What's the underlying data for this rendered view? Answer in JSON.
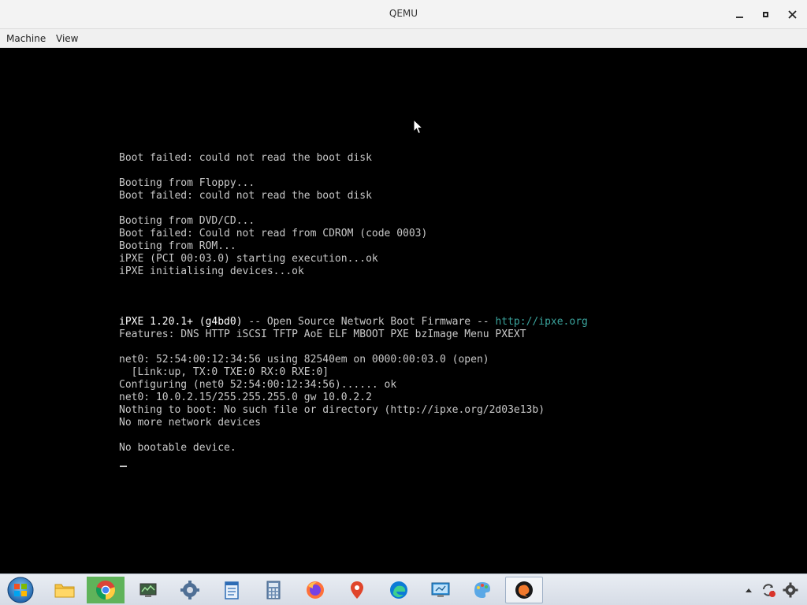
{
  "window": {
    "title": "QEMU"
  },
  "menu": {
    "items": [
      "Machine",
      "View"
    ]
  },
  "console": {
    "lines": [
      {
        "text": "Boot failed: could not read the boot disk"
      },
      {
        "text": ""
      },
      {
        "text": "Booting from Floppy..."
      },
      {
        "text": "Boot failed: could not read the boot disk"
      },
      {
        "text": ""
      },
      {
        "text": "Booting from DVD/CD..."
      },
      {
        "text": "Boot failed: Could not read from CDROM (code 0003)"
      },
      {
        "text": "Booting from ROM..."
      },
      {
        "text": "iPXE (PCI 00:03.0) starting execution...ok"
      },
      {
        "text": "iPXE initialising devices...ok"
      },
      {
        "text": ""
      },
      {
        "text": ""
      },
      {
        "text": ""
      },
      {
        "ipxe_banner": true
      },
      {
        "text": "Features: DNS HTTP iSCSI TFTP AoE ELF MBOOT PXE bzImage Menu PXEXT"
      },
      {
        "text": ""
      },
      {
        "text": "net0: 52:54:00:12:34:56 using 82540em on 0000:00:03.0 (open)"
      },
      {
        "text": "  [Link:up, TX:0 TXE:0 RX:0 RXE:0]"
      },
      {
        "text": "Configuring (net0 52:54:00:12:34:56)...... ok"
      },
      {
        "text": "net0: 10.0.2.15/255.255.255.0 gw 10.0.2.2"
      },
      {
        "text": "Nothing to boot: No such file or directory (http://ipxe.org/2d03e13b)"
      },
      {
        "text": "No more network devices"
      },
      {
        "text": ""
      },
      {
        "text": "No bootable device."
      }
    ],
    "banner": {
      "version": "iPXE 1.20.1+ (g4bd0)",
      "middle": " -- Open Source Network Boot Firmware -- ",
      "url": "http://ipxe.org"
    },
    "colors": {
      "text": "#c8c8c8",
      "bright": "#ffffff",
      "link": "#3aa39c",
      "background": "#000000"
    }
  },
  "taskbar": {
    "items": [
      {
        "name": "start-button",
        "icon": "windows-orb-icon"
      },
      {
        "name": "taskbar-file-explorer",
        "icon": "folder-icon"
      },
      {
        "name": "taskbar-chrome",
        "icon": "chrome-icon"
      },
      {
        "name": "taskbar-system-monitor",
        "icon": "monitor-icon"
      },
      {
        "name": "taskbar-settings",
        "icon": "gear-icon"
      },
      {
        "name": "taskbar-notepad",
        "icon": "notepad-icon"
      },
      {
        "name": "taskbar-calculator",
        "icon": "calculator-icon"
      },
      {
        "name": "taskbar-firefox",
        "icon": "firefox-icon"
      },
      {
        "name": "taskbar-maps",
        "icon": "map-pin-icon"
      },
      {
        "name": "taskbar-edge",
        "icon": "edge-icon"
      },
      {
        "name": "taskbar-remote-desktop",
        "icon": "remote-desktop-icon"
      },
      {
        "name": "taskbar-paint",
        "icon": "paint-icon"
      },
      {
        "name": "taskbar-qemu",
        "icon": "qemu-icon",
        "active": true
      }
    ]
  }
}
